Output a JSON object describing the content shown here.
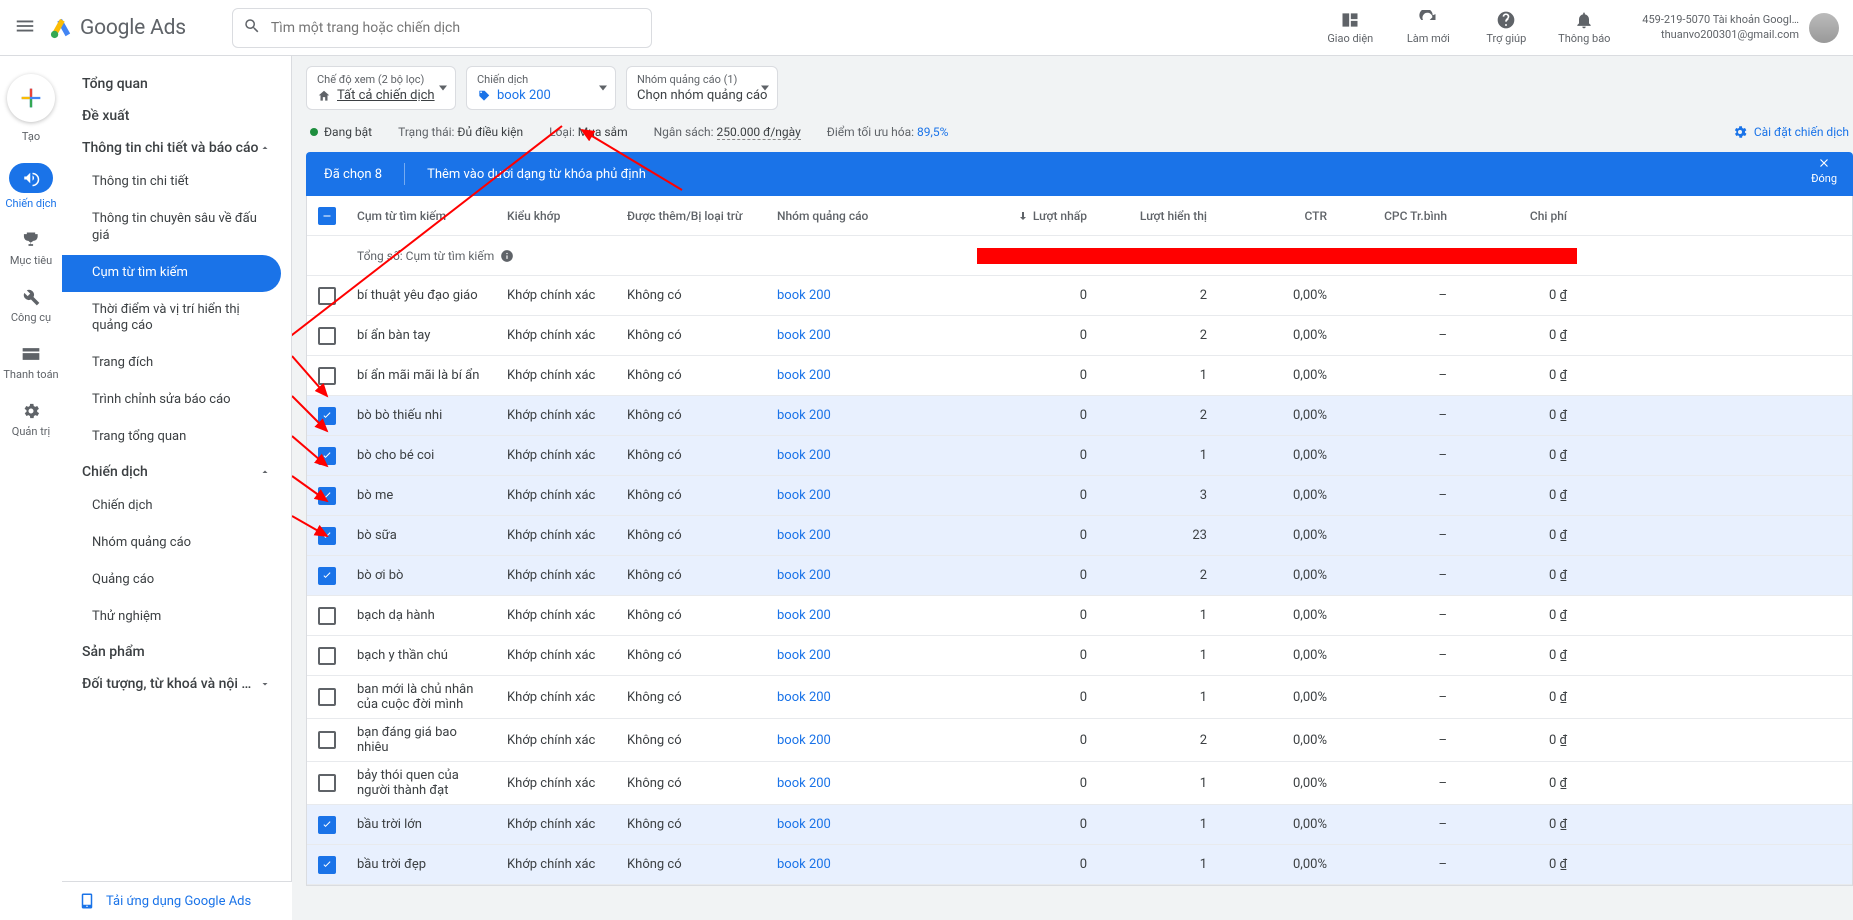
{
  "brand": "Google Ads",
  "search_placeholder": "Tìm một trang hoặc chiến dịch",
  "top_icons": {
    "appearance": "Giao diện",
    "refresh": "Làm mới",
    "help": "Trợ giúp",
    "notifications": "Thông báo"
  },
  "account": {
    "line1": "459-219-5070 Tài khoản Googl…",
    "line2": "thuanvo200301@gmail.com"
  },
  "rail": {
    "create": "Tạo",
    "campaigns": "Chiến dịch",
    "goals": "Mục tiêu",
    "tools": "Công cụ",
    "billing": "Thanh toán",
    "admin": "Quản trị"
  },
  "sidenav": {
    "overview": "Tổng quan",
    "recommendations": "Đề xuất",
    "insights_group": "Thông tin chi tiết và báo cáo",
    "insights_items": {
      "insights": "Thông tin chi tiết",
      "auction": "Thông tin chuyên sâu về đấu giá",
      "search_terms": "Cụm từ tìm kiếm",
      "when_where": "Thời điểm và vị trí hiển thị quảng cáo",
      "landing": "Trang đích",
      "report_editor": "Trình chỉnh sửa báo cáo",
      "dashboard": "Trang tổng quan"
    },
    "campaigns_group": "Chiến dịch",
    "campaigns_items": {
      "campaigns": "Chiến dịch",
      "adgroups": "Nhóm quảng cáo",
      "ads": "Quảng cáo",
      "experiments": "Thử nghiệm"
    },
    "products": "Sản phẩm",
    "audiences": "Đối tượng, từ khoá và nội …",
    "download_app": "Tải ứng dụng Google Ads"
  },
  "scope": {
    "view_sub": "Chế độ xem (2 bộ lọc)",
    "view_main": "Tất cả chiến dịch",
    "campaign_sub": "Chiến dịch",
    "campaign_main": "book 200",
    "adgroup_sub": "Nhóm quảng cáo (1)",
    "adgroup_main": "Chọn nhóm quảng cáo"
  },
  "status": {
    "enabled": "Đang bật",
    "state_label": "Trạng thái:",
    "state_value": "Đủ điều kiện",
    "type_label": "Loại:",
    "type_value": "Mua sắm",
    "budget_label": "Ngân sách:",
    "budget_value": "250.000 đ/ngày",
    "opt_label": "Điểm tối ưu hóa:",
    "opt_value": "89,5%",
    "settings": "Cài đặt chiến dịch"
  },
  "selbar": {
    "count": "Đã chọn 8",
    "action": "Thêm vào dưới dạng từ khóa phủ định",
    "close": "Đóng"
  },
  "table": {
    "headers": {
      "term": "Cụm từ tìm kiếm",
      "match": "Kiểu khớp",
      "added": "Được thêm/Bị loại trừ",
      "adgroup": "Nhóm quảng cáo",
      "clicks": "Lượt nhấp",
      "impr": "Lượt hiển thị",
      "ctr": "CTR",
      "cpc": "CPC Tr.bình",
      "cost": "Chi phí"
    },
    "totals_label": "Tổng số: Cụm từ tìm kiếm",
    "match_value": "Khớp chính xác",
    "added_value": "Không có",
    "adgroup_value": "book 200",
    "rows": [
      {
        "sel": false,
        "term": "bí thuật yêu đạo giáo",
        "clicks": "0",
        "impr": "2",
        "ctr": "0,00%",
        "cpc": "–",
        "cost": "0 ₫"
      },
      {
        "sel": false,
        "term": "bí ẩn bàn tay",
        "clicks": "0",
        "impr": "2",
        "ctr": "0,00%",
        "cpc": "–",
        "cost": "0 ₫"
      },
      {
        "sel": false,
        "term": "bí ẩn mãi mãi là bí ẩn",
        "clicks": "0",
        "impr": "1",
        "ctr": "0,00%",
        "cpc": "–",
        "cost": "0 ₫"
      },
      {
        "sel": true,
        "term": "bò bò thiếu nhi",
        "clicks": "0",
        "impr": "2",
        "ctr": "0,00%",
        "cpc": "–",
        "cost": "0 ₫"
      },
      {
        "sel": true,
        "term": "bò cho bé coi",
        "clicks": "0",
        "impr": "1",
        "ctr": "0,00%",
        "cpc": "–",
        "cost": "0 ₫"
      },
      {
        "sel": true,
        "term": "bò me",
        "clicks": "0",
        "impr": "3",
        "ctr": "0,00%",
        "cpc": "–",
        "cost": "0 ₫"
      },
      {
        "sel": true,
        "term": "bò sữa",
        "clicks": "0",
        "impr": "23",
        "ctr": "0,00%",
        "cpc": "–",
        "cost": "0 ₫"
      },
      {
        "sel": true,
        "term": "bò ơi bò",
        "clicks": "0",
        "impr": "2",
        "ctr": "0,00%",
        "cpc": "–",
        "cost": "0 ₫"
      },
      {
        "sel": false,
        "term": "bạch dạ hành",
        "clicks": "0",
        "impr": "1",
        "ctr": "0,00%",
        "cpc": "–",
        "cost": "0 ₫"
      },
      {
        "sel": false,
        "term": "bạch y thần chú",
        "clicks": "0",
        "impr": "1",
        "ctr": "0,00%",
        "cpc": "–",
        "cost": "0 ₫"
      },
      {
        "sel": false,
        "term": "ban mới là chủ nhân của cuộc đời mình",
        "clicks": "0",
        "impr": "1",
        "ctr": "0,00%",
        "cpc": "–",
        "cost": "0 ₫"
      },
      {
        "sel": false,
        "term": "bạn đáng giá bao nhiêu",
        "clicks": "0",
        "impr": "2",
        "ctr": "0,00%",
        "cpc": "–",
        "cost": "0 ₫"
      },
      {
        "sel": false,
        "term": "bảy thói quen của người thành đạt",
        "clicks": "0",
        "impr": "1",
        "ctr": "0,00%",
        "cpc": "–",
        "cost": "0 ₫"
      },
      {
        "sel": true,
        "term": "bầu trời lớn",
        "clicks": "0",
        "impr": "1",
        "ctr": "0,00%",
        "cpc": "–",
        "cost": "0 ₫"
      },
      {
        "sel": true,
        "term": "bầu trời đẹp",
        "clicks": "0",
        "impr": "1",
        "ctr": "0,00%",
        "cpc": "–",
        "cost": "0 ₫"
      }
    ]
  }
}
